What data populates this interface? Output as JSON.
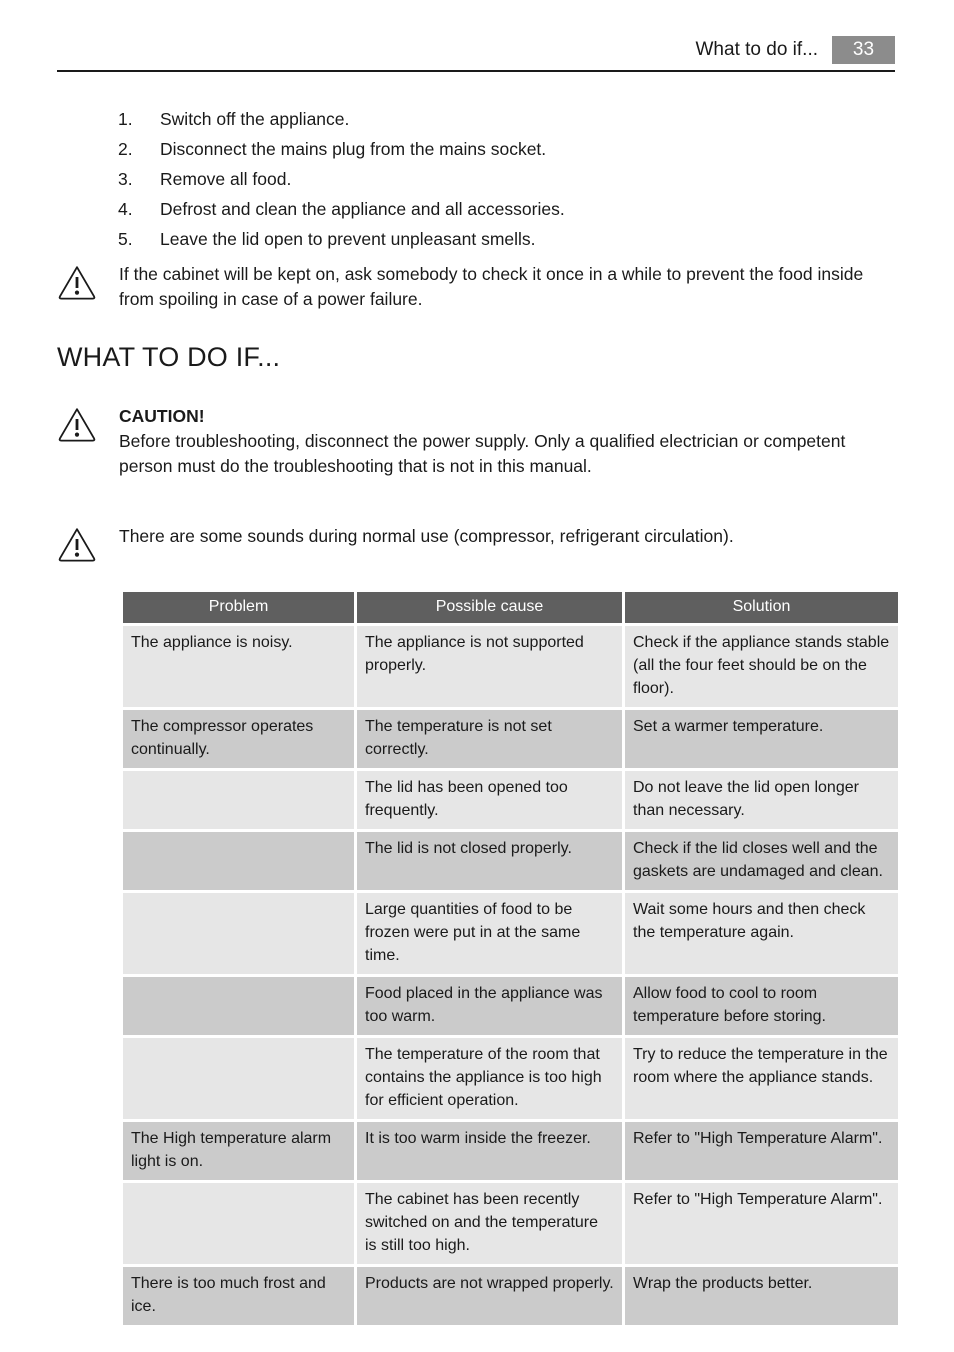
{
  "header": {
    "title": "What to do if...",
    "page_number": "33",
    "badge_color": "#8c8c8c"
  },
  "numbered_list": [
    {
      "num": "1.",
      "text": "Switch off the appliance."
    },
    {
      "num": "2.",
      "text": "Disconnect the mains plug from the mains socket."
    },
    {
      "num": "3.",
      "text": "Remove all food."
    },
    {
      "num": "4.",
      "text": "Defrost and clean the appliance and all accessories."
    },
    {
      "num": "5.",
      "text": "Leave the lid open to prevent unpleasant smells."
    }
  ],
  "notes": {
    "power_failure": {
      "icon": "warning-triangle-icon",
      "text": "If the cabinet will be kept on, ask somebody to check it once in a while to prevent the food inside from spoiling in case of a power failure."
    },
    "caution": {
      "icon": "warning-triangle-icon",
      "title": "CAUTION!",
      "text": "Before troubleshooting, disconnect the power supply. Only a qualified electrician or competent person must do the troubleshooting that is not in this manual."
    },
    "sounds": {
      "icon": "warning-triangle-icon",
      "text": "There are some sounds during normal use (compressor, refrigerant circulation)."
    }
  },
  "section_heading": "WHAT TO DO IF...",
  "table": {
    "header_bg": "#5f5f5f",
    "row_shade_dark": "#cbcbcb",
    "row_shade_light": "#e6e6e6",
    "columns": [
      "Problem",
      "Possible cause",
      "Solution"
    ],
    "rows": [
      {
        "problem": "The appliance is noisy.",
        "cause": "The appliance is not supported properly.",
        "solution": "Check if the appliance stands stable (all the four feet should be on the floor)."
      },
      {
        "problem": "The compressor operates continually.",
        "cause": "The temperature is not set correctly.",
        "solution": "Set a warmer temperature."
      },
      {
        "problem": "",
        "cause": "The lid has been opened too frequently.",
        "solution": "Do not leave the lid open longer than necessary."
      },
      {
        "problem": "",
        "cause": "The lid is not closed properly.",
        "solution": "Check if the lid closes well and the gaskets are undamaged and clean."
      },
      {
        "problem": "",
        "cause": "Large quantities of food to be frozen were put in at the same time.",
        "solution": "Wait some hours and then check the temperature again."
      },
      {
        "problem": "",
        "cause": "Food placed in the appliance was too warm.",
        "solution": "Allow food to cool to room temperature before storing."
      },
      {
        "problem": "",
        "cause": "The temperature of the room that contains the appliance is too high for efficient operation.",
        "solution": "Try to reduce the temperature in the room where the appliance stands."
      },
      {
        "problem": "The High temperature alarm light is on.",
        "cause": "It is too warm inside the freezer.",
        "solution": "Refer to \"High Temperature Alarm\"."
      },
      {
        "problem": "",
        "cause": "The cabinet has been recently switched on and the temperature is still too high.",
        "solution": "Refer to \"High Temperature Alarm\"."
      },
      {
        "problem": "There is too much frost and ice.",
        "cause": "Products are not wrapped properly.",
        "solution": "Wrap the products better."
      }
    ]
  }
}
